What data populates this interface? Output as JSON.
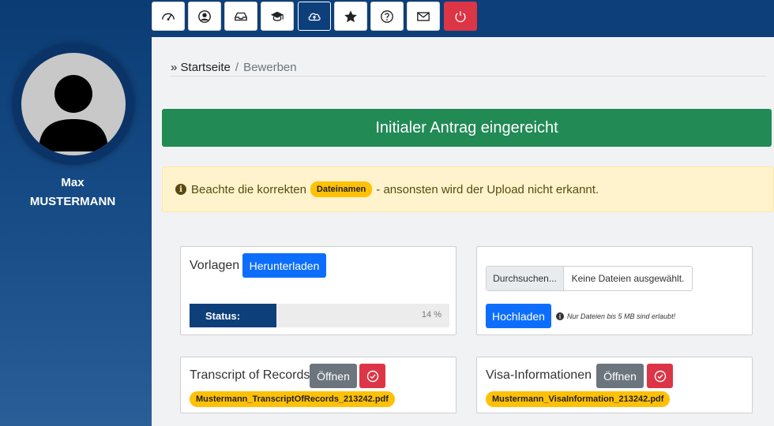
{
  "user": {
    "first_name": "Max",
    "last_name": "MUSTERMANN"
  },
  "toolbar": [
    {
      "icon": "dashboard-icon",
      "active": false
    },
    {
      "icon": "user-circle-icon",
      "active": false
    },
    {
      "icon": "inbox-icon",
      "active": false
    },
    {
      "icon": "graduation-cap-icon",
      "active": false
    },
    {
      "icon": "cloud-upload-icon",
      "active": true
    },
    {
      "icon": "star-icon",
      "active": false
    },
    {
      "icon": "question-icon",
      "active": false
    },
    {
      "icon": "envelope-icon",
      "active": false
    },
    {
      "icon": "power-icon",
      "active": false
    }
  ],
  "breadcrumb": {
    "prefix": "»",
    "home": "Startseite",
    "separator": "/",
    "current": "Bewerben"
  },
  "banner": {
    "text": "Initialer Antrag eingereicht",
    "color": "#218a55"
  },
  "alert": {
    "before": "Beachte die korrekten",
    "badge": "Dateinamen",
    "after": "- ansonsten wird der Upload nicht erkannt."
  },
  "templates_card": {
    "title": "Vorlagen",
    "download_label": "Herunterladen",
    "status_label": "Status:",
    "progress": 0.14,
    "progress_text": "14 %"
  },
  "upload_card": {
    "browse_label": "Durchsuchen...",
    "file_text": "Keine Dateien ausgewählt.",
    "upload_label": "Hochladen",
    "note": "Nur Dateien bis 5 MB sind erlaubt!"
  },
  "documents": [
    {
      "title": "Transcript of Records",
      "open_label": "Öffnen",
      "filename": "Mustermann_TranscriptOfRecords_213242.pdf"
    },
    {
      "title": "Visa-Informationen",
      "open_label": "Öffnen",
      "filename": "Mustermann_VisaInformation_213242.pdf"
    }
  ],
  "colors": {
    "primary": "#0d6efd",
    "danger": "#dc3545",
    "navy": "#0d3f7a",
    "warning": "#ffc107"
  }
}
